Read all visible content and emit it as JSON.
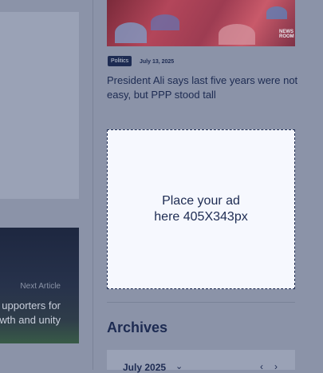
{
  "next_article": {
    "label": "Next Article",
    "title_line1": "upporters for",
    "title_line2": "wth and unity"
  },
  "news_item": {
    "category": "Politics",
    "date": "July 13, 2025",
    "headline": "President Ali says last five years were not easy, but PPP stood tall",
    "photo_logo": "NEWS ROOM"
  },
  "ad": {
    "text_line1": "Place your ad",
    "text_line2": "here 405X343px"
  },
  "archives": {
    "title": "Archives",
    "month": "July 2025",
    "icons": {
      "month_dropdown": "chevron-down-icon",
      "prev": "chevron-left-icon",
      "next": "chevron-right-icon"
    }
  },
  "colors": {
    "overlay": "#8b93a8",
    "navy": "#1d2b52",
    "ad_background": "#f6f8fe"
  }
}
